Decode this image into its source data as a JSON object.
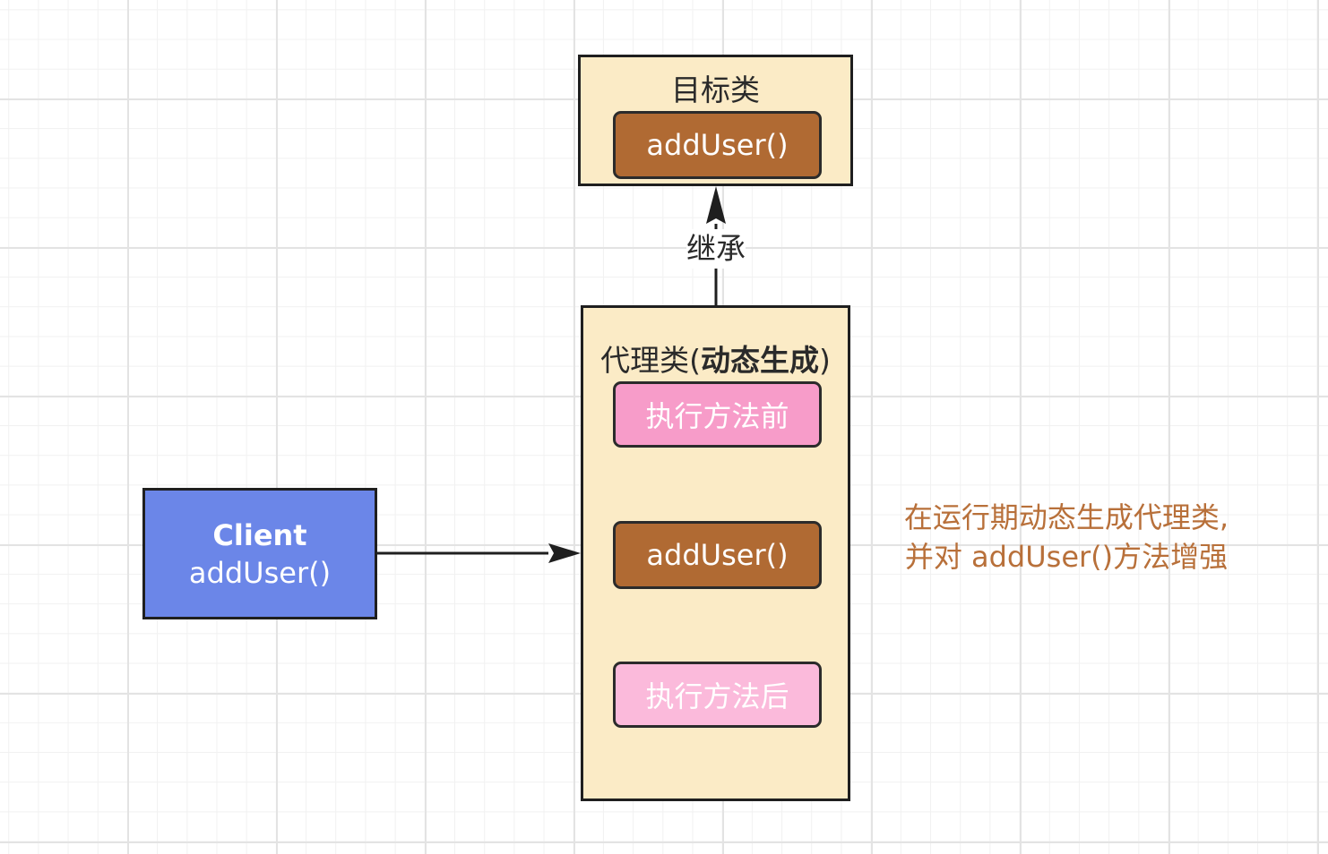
{
  "target_class": {
    "title": "目标类",
    "method": "addUser()"
  },
  "inherit_label": "继承",
  "proxy_class": {
    "title_prefix": "代理类(",
    "title_strong": "动态生成",
    "title_suffix": ")",
    "before": "执行方法前",
    "method": "addUser()",
    "after": "执行方法后"
  },
  "client": {
    "title": "Client",
    "method": "addUser()"
  },
  "note": {
    "line1": "在运行期动态生成代理类,",
    "line2": "并对 addUser()方法增强"
  },
  "colors": {
    "class_fill": "#fbebc6",
    "method_brown": "#b06a33",
    "method_pink": "#f79cc9",
    "method_pink_light": "#fbbadb",
    "client_fill": "#6b86e8",
    "note_text": "#b8703a"
  }
}
